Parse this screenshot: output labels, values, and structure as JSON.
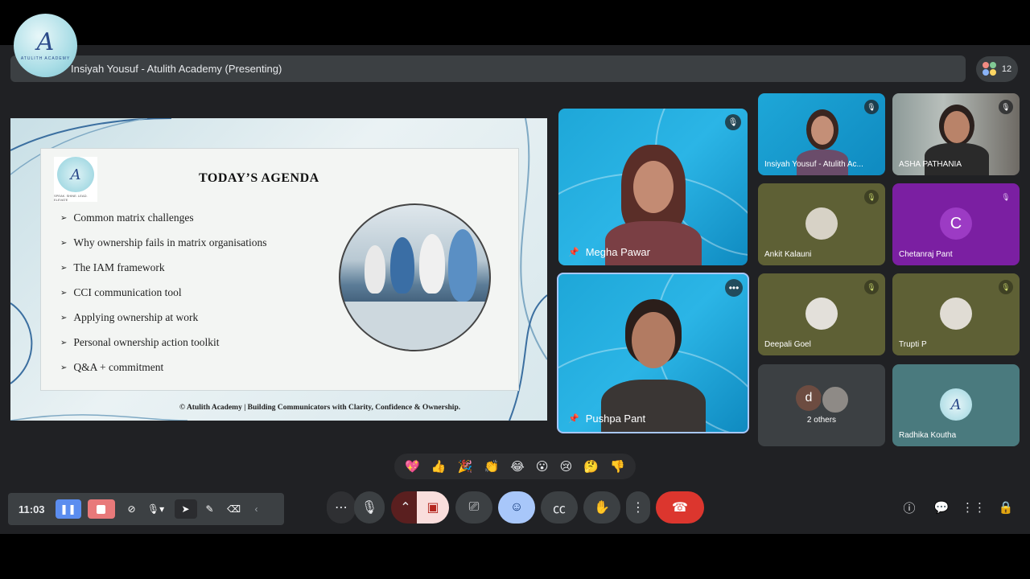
{
  "branding": {
    "logo_monogram": "A",
    "logo_text": "ATULITH ACADEMY"
  },
  "topbar": {
    "presenter_title": "Insiyah Yousuf - Atulith Academy (Presenting)"
  },
  "participants": {
    "count": "12"
  },
  "slide": {
    "logo_monogram": "A",
    "logo_tagline": "SPEAK. SHINE. LEAD. ELEVATE",
    "heading": "TODAY’S AGENDA",
    "items": [
      "Common matrix challenges",
      "Why ownership fails in matrix organisations",
      "The  IAM  framework",
      "CCI communication tool",
      "Applying ownership at work",
      "Personal ownership action toolkit",
      "Q&A + commitment"
    ],
    "bullet_glyph": "➢",
    "footer": "© Atulith Academy | Building Communicators with Clarity, Confidence & Ownership."
  },
  "main_tiles": [
    {
      "name": "Megha Pawar",
      "state": "mic-off"
    },
    {
      "name": "Pushpa Pant",
      "state": "speaking"
    }
  ],
  "grid_tiles": [
    {
      "name": "Insiyah Yousuf - Atulith Ac...",
      "avatar": ""
    },
    {
      "name": "ASHA PATHANIA",
      "avatar": ""
    },
    {
      "name": "Ankit Kalauni",
      "avatar": ""
    },
    {
      "name": "Chetanraj Pant",
      "avatar": "C"
    },
    {
      "name": "Deepali Goel",
      "avatar": ""
    },
    {
      "name": "Trupti P",
      "avatar": ""
    },
    {
      "name": "2 others",
      "avatar": "d"
    },
    {
      "name": "Radhika Koutha",
      "avatar": "A"
    }
  ],
  "reactions": [
    "💖",
    "👍",
    "🎉",
    "👏",
    "😂",
    "😮",
    "😢",
    "🤔",
    "👎"
  ],
  "toolbar": {
    "timer": "11:03"
  },
  "colors": {
    "stage": "#202124",
    "tile_bg": "#5f6133",
    "purple": "#7b1fa2",
    "end_call": "#d93025",
    "accent_blue": "#8ab4f8"
  },
  "icons": [
    "more-icon",
    "mic-icon",
    "chevron-up-icon",
    "camera-off-icon",
    "present-icon",
    "emoji-icon",
    "captions-icon",
    "raise-hand-icon",
    "more-vert-icon",
    "end-call-icon",
    "info-icon",
    "chat-icon",
    "apps-icon",
    "host-controls-icon"
  ]
}
